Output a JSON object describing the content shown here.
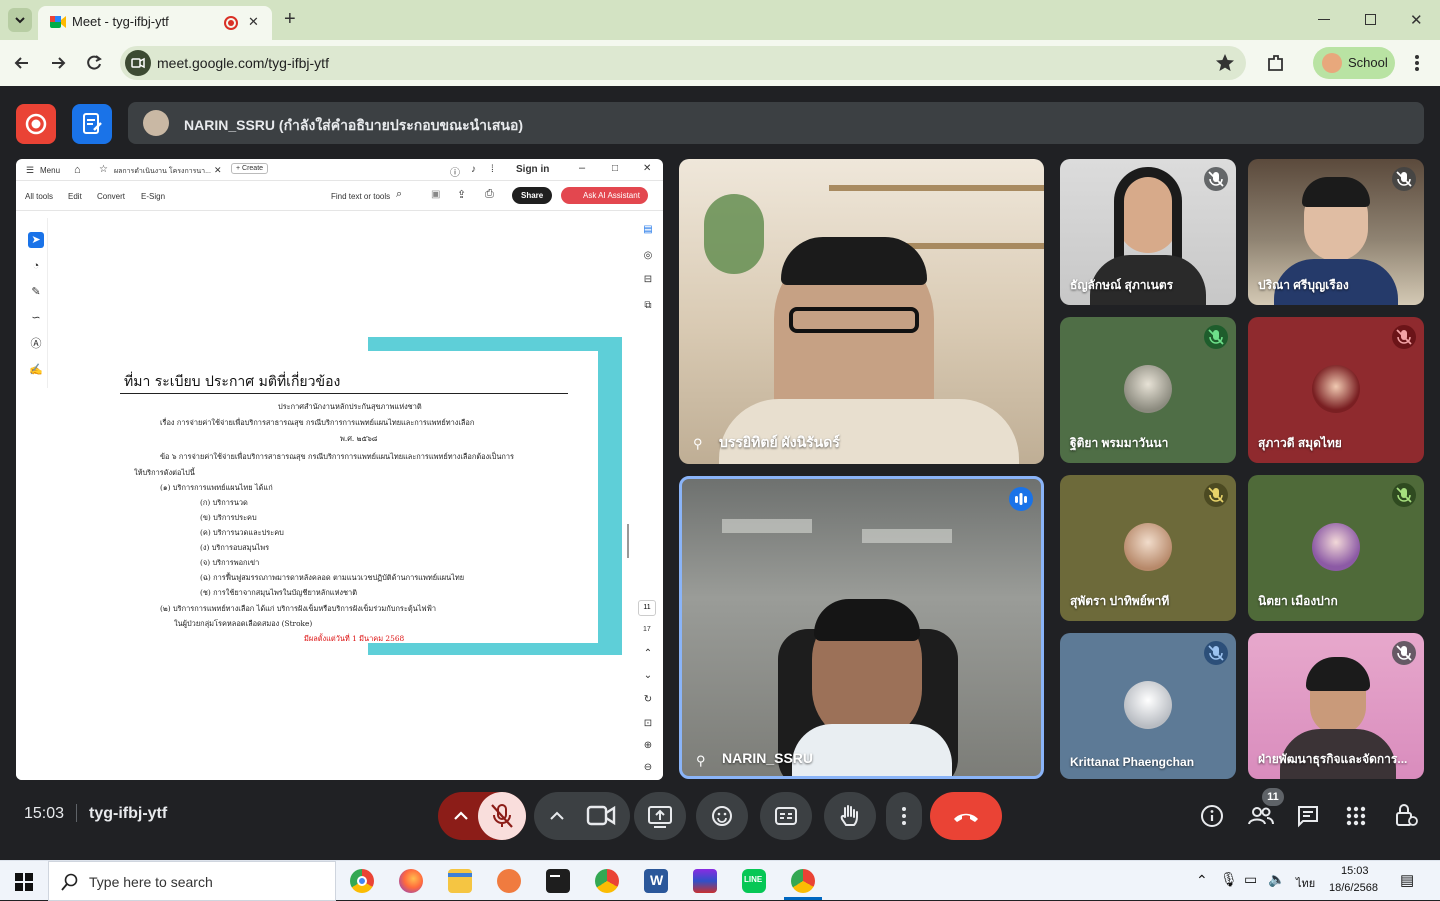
{
  "browser": {
    "tab_title": "Meet - tyg-ifbj-ytf",
    "url": "meet.google.com/tyg-ifbj-ytf",
    "profile_label": "School",
    "new_tab_glyph": "+",
    "close_glyph": "✕",
    "icons": [
      "tab-list-icon",
      "meet-favicon",
      "recording-icon",
      "back-icon",
      "forward-icon",
      "reload-icon",
      "site-info-icon",
      "bookmark-star-icon",
      "extensions-icon",
      "menu-icon",
      "minimize-icon",
      "maximize-icon",
      "close-icon"
    ]
  },
  "meet": {
    "presenter_banner": "NARIN_SSRU (กำลังใส่คำอธิบายประกอบขณะนำเสนอ)",
    "accent_record": "#ea4335",
    "accent_annotate": "#1a73e8",
    "presentation": {
      "app_toolbar": {
        "menu_label": "Menu",
        "doc_tab": "ผลการดำเนินงาน โครงการนา...",
        "create_label": "+ Create",
        "sign_in": "Sign in",
        "menu_items": [
          "All tools",
          "Edit",
          "Convert",
          "E-Sign"
        ],
        "find_placeholder": "Find text or tools",
        "share_label": "Share",
        "ai_label": "Ask AI Assistant",
        "page_current": "11",
        "page_total": "17"
      },
      "slide": {
        "heading": "ที่มา  ระเบียบ ประกาศ มติที่เกี่ยวข้อง",
        "lines": [
          "ประกาศสำนักงานหลักประกันสุขภาพแห่งชาติ",
          "เรื่อง การจ่ายค่าใช้จ่ายเพื่อบริการสาธารณสุข กรณีบริการการแพทย์แผนไทยและการแพทย์ทางเลือก",
          "พ.ศ. ๒๕๖๘",
          "ข้อ ๖ การจ่ายค่าใช้จ่ายเพื่อบริการสาธารณสุข กรณีบริการการแพทย์แผนไทยและการแพทย์ทางเลือกต้องเป็นการ",
          "ให้บริการดังต่อไปนี้",
          "(๑) บริการการแพทย์แผนไทย ได้แก่",
          "(ก) บริการนวด",
          "(ข) บริการประคบ",
          "(ค) บริการนวดและประคบ",
          "(ง) บริการอบสมุนไพร",
          "(จ) บริการพอกเข่า",
          "(ฉ) การฟื้นฟูสมรรถภาพมารดาหลังคลอด ตามแนวเวชปฏิบัติด้านการแพทย์แผนไทย",
          "(ช) การใช้ยาจากสมุนไพรในบัญชียาหลักแห่งชาติ",
          "(๒) บริการการแพทย์ทางเลือก ได้แก่ บริการฝังเข็มหรือบริการฝังเข็มร่วมกับกระตุ้นไฟฟ้า",
          "ในผู้ป่วยกลุ่มโรคหลอดเลือดสมอง (Stroke)",
          "มีผลตั้งแต่วันที่ 1 มีนาคม 2568"
        ]
      }
    },
    "participants": [
      {
        "name": "บรรยิทิตย์ ผังนิรันดร์",
        "pinned": true,
        "kind": "video"
      },
      {
        "name": "NARIN_SSRU",
        "pinned": true,
        "speaking": true,
        "kind": "video"
      },
      {
        "name": "ธัญลักษณ์ สุภาเนตร",
        "muted": true,
        "kind": "video"
      },
      {
        "name": "ปริณา ศรีบุญเรือง",
        "muted": true,
        "kind": "video"
      },
      {
        "name": "ฐิติยา พรมมาวันนา",
        "muted": true,
        "kind": "avatar",
        "bg": "#4f6e46"
      },
      {
        "name": "สุภาวดี สมุดไทย",
        "muted": true,
        "kind": "avatar",
        "bg": "#8f2a2e"
      },
      {
        "name": "สุพัตรา ปาทิพย์พาที",
        "muted": true,
        "kind": "avatar",
        "bg": "#6d6a3a"
      },
      {
        "name": "นิตยา เมืองปาก",
        "muted": true,
        "kind": "avatar",
        "bg": "#4f6a39"
      },
      {
        "name": "Krittanat Phaengchan",
        "muted": true,
        "kind": "avatar",
        "bg": "#5d7a96"
      },
      {
        "name": "ฝ่ายพัฒนาธุรกิจและจัดการ...",
        "muted": true,
        "kind": "video"
      }
    ],
    "bottom": {
      "time": "15:03",
      "meeting_code": "tyg-ifbj-ytf",
      "people_count": "11",
      "hangup_color": "#ea4335"
    }
  },
  "taskbar": {
    "search_placeholder": "Type here to search",
    "lang": "ไทย",
    "time": "15:03",
    "date": "18/6/2568"
  }
}
